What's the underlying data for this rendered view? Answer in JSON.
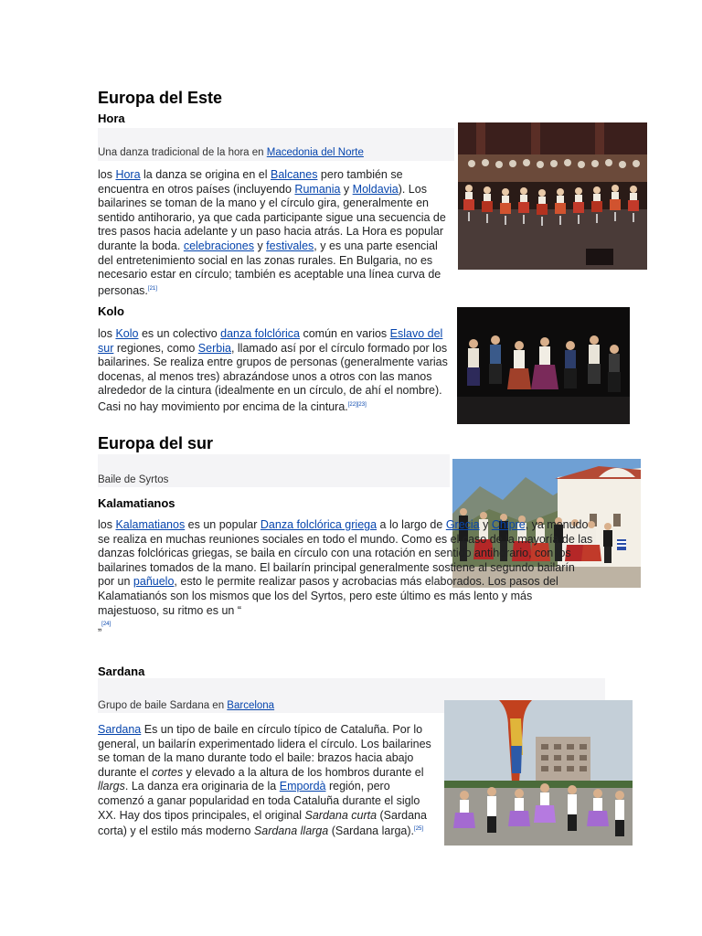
{
  "sections": {
    "east": {
      "title": "Europa del Este",
      "hora": {
        "heading": "Hora",
        "caption_text": "Una danza tradicional de la hora en ",
        "caption_link": "Macedonia del Norte",
        "p": [
          "los ",
          "Hora",
          " la danza se origina en el ",
          "Balcanes",
          " pero también se encuentra en otros países (incluyendo ",
          "Rumania",
          " y ",
          "Moldavia",
          "). Los bailarines se toman de la mano y el círculo gira, generalmente en sentido antihorario, ya que cada participante sigue una secuencia de tres pasos hacia adelante y un paso hacia atrás. La Hora es popular durante la boda. ",
          "celebraciones",
          " y ",
          "festivales",
          ", y es una parte esencial del entretenimiento social en las zonas rurales. En Bulgaria, no es necesario estar en círculo; también es aceptable una línea curva de personas."
        ],
        "ref": "[21]"
      },
      "kolo": {
        "heading": "Kolo",
        "p": [
          "los ",
          "Kolo",
          " es un colectivo ",
          "danza folclórica",
          " común en varios ",
          "Eslavo del sur",
          " regiones, como ",
          "Serbia",
          ", llamado así por el círculo formado por los bailarines. Se realiza entre grupos de personas (generalmente varias docenas, al menos tres) abrazándose unos a otros con las manos alrededor de la cintura (idealmente en un círculo, de ahí el nombre). Casi no hay movimiento por encima de la cintura."
        ],
        "ref": "[22][23]"
      }
    },
    "south": {
      "title": "Europa del sur",
      "caption": "Baile de Syrtos",
      "kalamatianos": {
        "heading": "Kalamatianos",
        "p": [
          "los ",
          "Kalamatianos",
          " es un popular ",
          "Danza folclórica griega",
          " a lo largo de ",
          "Grecia",
          " y ",
          "Chipre",
          ", ya menudo se realiza en muchas reuniones sociales en todo el mundo. Como es el caso de la mayoría de las danzas folclóricas griegas, se baila en círculo con una rotación en sentido antihorario, con los bailarines tomados de la mano. El bailarín principal generalmente sostiene al segundo bailarín por un ",
          "pañuelo",
          ", esto le permite realizar pasos y acrobacias más elaborados. Los pasos del Kalamatianós son los mismos que los del Syrtos, pero este último es más lento y más majestuoso, su ritmo es un “"
        ],
        "tail": "„",
        "ref": "[24]"
      },
      "sardana": {
        "heading": "Sardana",
        "caption_text": "Grupo de baile Sardana en ",
        "caption_link": "Barcelona",
        "p": [
          "Sardana",
          " Es un tipo de baile en círculo típico de Cataluña. Por lo general, un bailarín experimentado lidera el círculo. Los bailarines se toman de la mano durante todo el baile: brazos hacia abajo durante el ",
          "cortes",
          " y elevado a la altura de los hombros durante el ",
          "llargs",
          ". La danza era originaria de la ",
          "Empordà",
          " región, pero comenzó a ganar popularidad en toda Cataluña durante el siglo XX. Hay dos tipos principales, el original ",
          "Sardana curta",
          " (Sardana corta) y el estilo más moderno ",
          "Sardana llarga",
          " (Sardana larga)."
        ],
        "ref": "[25]"
      }
    }
  }
}
